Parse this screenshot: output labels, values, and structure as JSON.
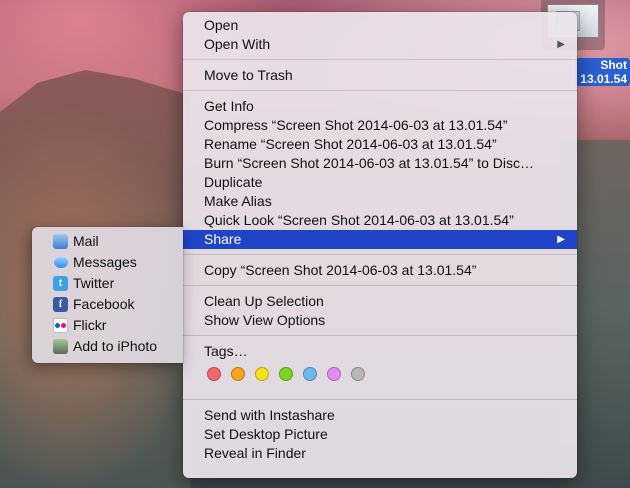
{
  "desktop": {
    "file_label_line1": "Shot",
    "file_label_line2": "13.01.54"
  },
  "menu": {
    "open": "Open",
    "open_with": "Open With",
    "move_to_trash": "Move to Trash",
    "get_info": "Get Info",
    "compress": "Compress “Screen Shot 2014-06-03 at 13.01.54”",
    "rename": "Rename “Screen Shot 2014-06-03 at 13.01.54”",
    "burn": "Burn “Screen Shot 2014-06-03 at 13.01.54” to Disc…",
    "duplicate": "Duplicate",
    "make_alias": "Make Alias",
    "quick_look": "Quick Look “Screen Shot 2014-06-03 at 13.01.54”",
    "share": "Share",
    "copy": "Copy “Screen Shot 2014-06-03 at 13.01.54”",
    "clean_up": "Clean Up Selection",
    "view_options": "Show View Options",
    "tags": "Tags…",
    "tag_colors": [
      "#f0686b",
      "#f9a31b",
      "#f7e21a",
      "#7fd322",
      "#6cb9f0",
      "#e48af1",
      "#b8b8b8"
    ],
    "instashare": "Send with Instashare",
    "desktop_picture": "Set Desktop Picture",
    "reveal": "Reveal in Finder",
    "submenu_arrow": "▶"
  },
  "share_menu": {
    "mail": "Mail",
    "messages": "Messages",
    "twitter": "Twitter",
    "facebook": "Facebook",
    "flickr": "Flickr",
    "iphoto": "Add to iPhoto",
    "icon_twitter_glyph": "t",
    "icon_facebook_glyph": "f"
  },
  "colors": {
    "selection": "#1f44c7",
    "file_label_bg": "#2a5fd6"
  }
}
